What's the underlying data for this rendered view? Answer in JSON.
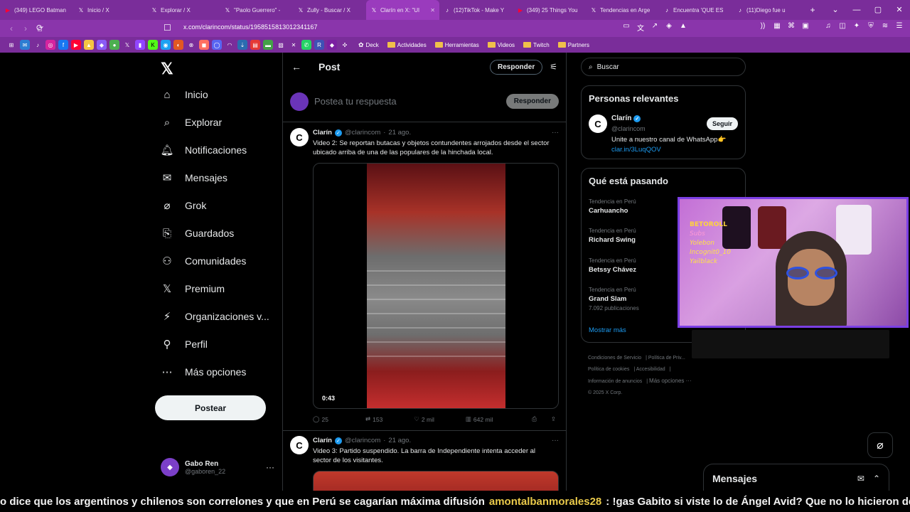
{
  "browser": {
    "tabs": [
      {
        "label": "(349) LEGO Batman",
        "icon": "youtube-icon",
        "icon_color": "#ff0033"
      },
      {
        "label": "Inicio / X",
        "icon": "x-icon",
        "icon_color": "#ffffff"
      },
      {
        "label": "Explorar / X",
        "icon": "x-icon",
        "icon_color": "#ffffff"
      },
      {
        "label": "\"Paolo Guerrero\" - ",
        "icon": "x-icon",
        "icon_color": "#ffffff"
      },
      {
        "label": "Zully - Buscar / X",
        "icon": "x-icon",
        "icon_color": "#ffffff"
      },
      {
        "label": "Clarín en X: \"Ul",
        "icon": "x-icon",
        "icon_color": "#ffffff",
        "active": true
      },
      {
        "label": "(12)TikTok - Make Y",
        "icon": "tiktok-icon",
        "icon_color": "#ffffff"
      },
      {
        "label": "(349) 25 Things You",
        "icon": "youtube-icon",
        "icon_color": "#ff0033"
      },
      {
        "label": "Tendencias en Arge",
        "icon": "x-icon",
        "icon_color": "#ffffff"
      },
      {
        "label": "Encuentra 'QUE ES",
        "icon": "tiktok-icon",
        "icon_color": "#ffffff"
      },
      {
        "label": "(11)Diego fue u",
        "icon": "tiktok-icon",
        "icon_color": "#ffffff"
      }
    ],
    "url": "x.com/clarincom/status/1958515813012341167",
    "bookmark_folders": [
      "Deck",
      "Actividades",
      "Herramientas",
      "Videos",
      "Twitch",
      "Partners"
    ]
  },
  "nav": {
    "items": [
      {
        "label": "Inicio",
        "icon": "home-icon"
      },
      {
        "label": "Explorar",
        "icon": "search-icon"
      },
      {
        "label": "Notificaciones",
        "icon": "bell-icon"
      },
      {
        "label": "Mensajes",
        "icon": "mail-icon"
      },
      {
        "label": "Grok",
        "icon": "grok-icon"
      },
      {
        "label": "Guardados",
        "icon": "bookmark-icon"
      },
      {
        "label": "Comunidades",
        "icon": "communities-icon"
      },
      {
        "label": "Premium",
        "icon": "x-icon"
      },
      {
        "label": "Organizaciones v...",
        "icon": "lightning-icon"
      },
      {
        "label": "Perfil",
        "icon": "person-icon"
      },
      {
        "label": "Más opciones",
        "icon": "more-circle-icon"
      }
    ],
    "post_button": "Postear",
    "profile": {
      "name": "Gabo Ren",
      "handle": "@gaboren_22"
    }
  },
  "main": {
    "header_title": "Post",
    "header_reply": "Responder",
    "composer_placeholder": "Postea tu respuesta",
    "composer_reply": "Responder",
    "tweets": [
      {
        "name": "Clarín",
        "handle": "@clarincom",
        "date": "21 ago.",
        "text": "Video 2: Se reportan butacas y objetos contundentes arrojados desde el sector ubicado arriba de una de las populares de la hinchada local.",
        "video_duration": "0:43",
        "replies": "25",
        "reposts": "153",
        "likes": "2 mil",
        "views": "642 mil"
      },
      {
        "name": "Clarín",
        "handle": "@clarincom",
        "date": "21 ago.",
        "text": "Video 3: Partido suspendido. La barra de Independiente intenta acceder al sector de los visitantes."
      }
    ]
  },
  "right": {
    "search_placeholder": "Buscar",
    "relevant": {
      "title": "Personas relevantes",
      "name": "Clarín",
      "handle": "@clarincom",
      "follow": "Seguir",
      "bio": "Unite a nuestro canal de WhatsApp👉",
      "link": "clar.in/3LuqQOV"
    },
    "trends": {
      "title": "Qué está pasando",
      "items": [
        {
          "category": "Tendencia en Perú",
          "name": "Carhuancho"
        },
        {
          "category": "Tendencia en Perú",
          "name": "Richard Swing"
        },
        {
          "category": "Tendencia en Perú",
          "name": "Betssy Chávez"
        },
        {
          "category": "Tendencia en Perú",
          "name": "Grand Slam",
          "count": "7.092 publicaciones"
        }
      ],
      "show_more": "Mostrar más"
    },
    "footer": [
      "Condiciones de Servicio",
      "Política de Priv...",
      "Política de cookies",
      "Accesibilidad",
      "Información de anuncios",
      "Más opciones ···",
      "© 2025 X Corp."
    ]
  },
  "overlay": {
    "cam_lines": [
      "BETOROLL",
      "Subs",
      "Yolebon",
      "Incognit0_10",
      "Yailblack"
    ]
  },
  "messages": {
    "title": "Mensajes"
  },
  "ticker": {
    "text": "o dice que los argentinos y chilenos son correlones y que en Perú se cagarían máxima difusión",
    "user": "amontalbanmorales28",
    "message": ": !gas Gabito si viste lo de Ángel Avid? Que no lo hicieron debutar??"
  },
  "colors": {
    "accent": "#1d9bf0",
    "browser": "#7a2d9a",
    "overlay_border": "#7b3fe4"
  }
}
